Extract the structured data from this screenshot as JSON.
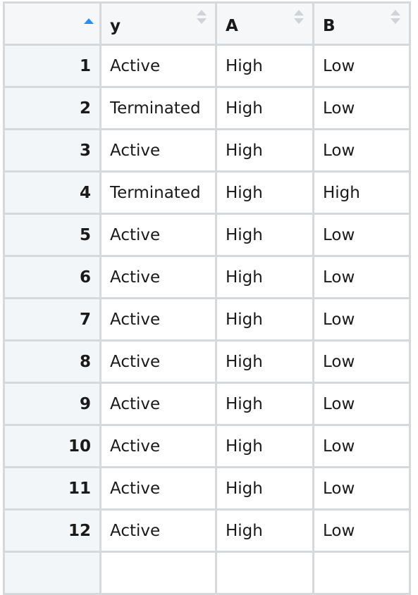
{
  "table": {
    "columns": [
      {
        "label": "",
        "sort": "ascending"
      },
      {
        "label": "y",
        "sort": "none"
      },
      {
        "label": "A",
        "sort": "none"
      },
      {
        "label": "B",
        "sort": "none"
      }
    ],
    "rows": [
      {
        "index": "1",
        "y": "Active",
        "A": "High",
        "B": "Low"
      },
      {
        "index": "2",
        "y": "Terminated",
        "A": "High",
        "B": "Low"
      },
      {
        "index": "3",
        "y": "Active",
        "A": "High",
        "B": "Low"
      },
      {
        "index": "4",
        "y": "Terminated",
        "A": "High",
        "B": "High"
      },
      {
        "index": "5",
        "y": "Active",
        "A": "High",
        "B": "Low"
      },
      {
        "index": "6",
        "y": "Active",
        "A": "High",
        "B": "Low"
      },
      {
        "index": "7",
        "y": "Active",
        "A": "High",
        "B": "Low"
      },
      {
        "index": "8",
        "y": "Active",
        "A": "High",
        "B": "Low"
      },
      {
        "index": "9",
        "y": "Active",
        "A": "High",
        "B": "Low"
      },
      {
        "index": "10",
        "y": "Active",
        "A": "High",
        "B": "Low"
      },
      {
        "index": "11",
        "y": "Active",
        "A": "High",
        "B": "Low"
      },
      {
        "index": "12",
        "y": "Active",
        "A": "High",
        "B": "Low"
      },
      {
        "index": "",
        "y": "",
        "A": "",
        "B": ""
      }
    ]
  },
  "colors": {
    "sort_active": "#2b8ef0",
    "sort_inactive": "#cfd3d7",
    "border": "#d6d9dc",
    "header_bg": "#f5f7f9"
  }
}
